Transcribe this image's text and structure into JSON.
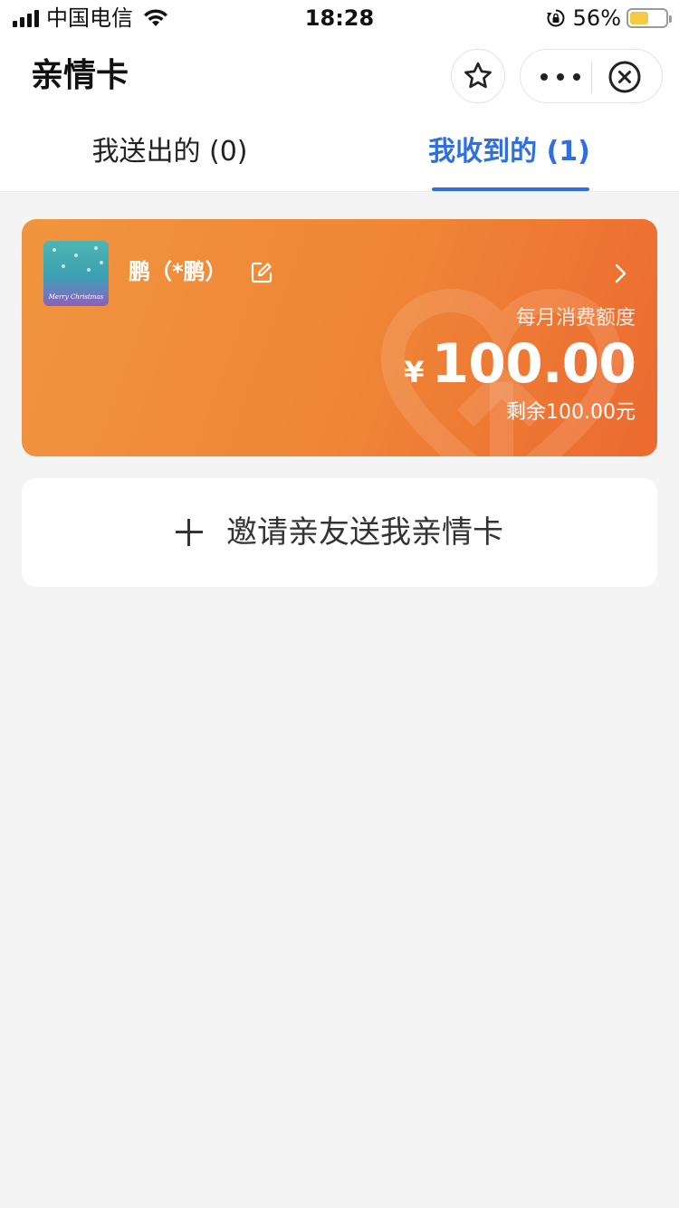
{
  "status_bar": {
    "carrier": "中国电信",
    "time": "18:28",
    "battery_percent": "56%",
    "battery_level": 0.56,
    "battery_color": "#f7c842",
    "icons": [
      "signal-icon",
      "wifi-icon",
      "orientation-lock-icon",
      "battery-icon"
    ]
  },
  "nav": {
    "title": "亲情卡",
    "icons": [
      "star-icon",
      "more-icon",
      "close-icon"
    ]
  },
  "tabs": [
    {
      "label": "我送出的 (0)",
      "active": false
    },
    {
      "label": "我收到的 (1)",
      "active": true
    }
  ],
  "card": {
    "name": "鹏（*鹏）",
    "thumb_caption": "Merry Christmas",
    "limit_label": "每月消费额度",
    "currency": "¥",
    "amount": "100.00",
    "remaining": "剩余100.00元",
    "icons": [
      "edit-icon",
      "chevron-right-icon"
    ],
    "gradient_colors": [
      "#f0953f",
      "#ec6a30"
    ]
  },
  "invite": {
    "label": "邀请亲友送我亲情卡",
    "icon": "plus-icon"
  },
  "colors": {
    "accent": "#2f6fe0",
    "background": "#f4f4f4"
  }
}
